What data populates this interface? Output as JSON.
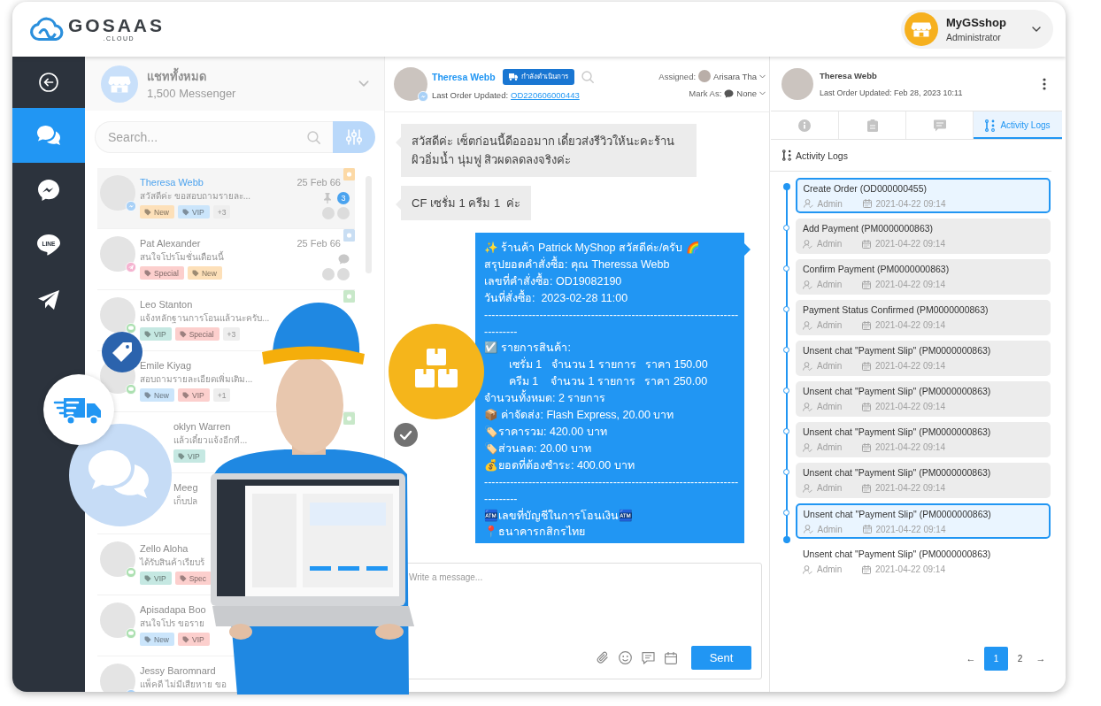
{
  "header": {
    "logo": {
      "name": "GOSAAS",
      "suffix": ".CLOUD"
    },
    "account": {
      "name": "MyGSshop",
      "role": "Administrator"
    }
  },
  "sidebar": {
    "items": [
      {
        "kind": "chats",
        "selected": true
      },
      {
        "kind": "messenger",
        "selected": false
      },
      {
        "kind": "line",
        "label": "LINE",
        "selected": false
      },
      {
        "kind": "send",
        "selected": false
      }
    ]
  },
  "chat_list": {
    "title": "แชททั้งหมด",
    "subtitle": "1,500 Messenger",
    "search": {
      "placeholder": "Search..."
    },
    "conversations": [
      {
        "name": "Theresa Webb",
        "preview": "สวัสดีค่ะ ขอสอบถามรายละ...",
        "date": "25 Feb 66",
        "channel": {
          "kind": "messenger"
        },
        "color": "#fcd9a6",
        "indicator": {
          "kind": "pinned"
        },
        "unread": "3",
        "tags": [
          {
            "label": "New",
            "color": "#fde0b9"
          },
          {
            "label": "VIP",
            "color": "#cbe5fb"
          }
        ],
        "more": "+3",
        "selected": true
      },
      {
        "name": "Pat Alexander",
        "preview": "สนใจโปรโมชั่นเดือนนี้",
        "date": "25 Feb 66",
        "channel": {
          "kind": "instagram"
        },
        "color": "#c9def3",
        "indicator": {
          "kind": "replied"
        },
        "tags": [
          {
            "label": "Special",
            "color": "#fccfcd"
          },
          {
            "label": "New",
            "color": "#fde0b9"
          }
        ],
        "selected": false
      },
      {
        "name": "Leo Stanton",
        "preview": "แจ้งหลักฐานการโอนแล้วนะครับ...",
        "channel": {
          "kind": "line"
        },
        "color": "#c8e8c9",
        "tags": [
          {
            "label": "VIP",
            "color": "#c5e8e2"
          },
          {
            "label": "Special",
            "color": "#fccfcd"
          }
        ],
        "more": "+3",
        "selected": false
      },
      {
        "name": "Emile Kiyag",
        "preview": "สอบถามรายละเอียดเพิ่มเติม...",
        "channel": {
          "kind": "line"
        },
        "tags": [
          {
            "label": "New",
            "color": "#cbe5fb"
          },
          {
            "label": "VIP",
            "color": "#fccfcd"
          }
        ],
        "more": "+1",
        "selected": false
      },
      {
        "name": "oklyn Warren",
        "preview": "แล้วเดี๋ยวแจ้งอีกที...",
        "color": "#c8e8c9",
        "tags": [
          {
            "label": "VIP",
            "color": "#c5e8e2"
          }
        ],
        "selected": false
      },
      {
        "name": "Meeg",
        "preview": "เก็บปล",
        "selected": false
      },
      {
        "name": "Zello Aloha",
        "preview": "ได้รับสินค้าเรียบร้",
        "channel": {
          "kind": "line"
        },
        "tags": [
          {
            "label": "VIP",
            "color": "#c5e8e2"
          },
          {
            "label": "Spec",
            "color": "#fccfcd"
          }
        ],
        "selected": false
      },
      {
        "name": "Apisadapa Boo",
        "preview": "สนใจโปร ขอราย",
        "channel": {
          "kind": "line"
        },
        "tags": [
          {
            "label": "New",
            "color": "#cbe5fb"
          },
          {
            "label": "VIP",
            "color": "#fccfcd"
          }
        ],
        "selected": false
      },
      {
        "name": "Jessy Baromnard",
        "preview": "แพ็คดี ไม่มีเสียหาย ขอ",
        "channel": {
          "kind": "messenger"
        },
        "selected": false
      }
    ]
  },
  "conversation": {
    "contact": {
      "name": "Theresa Webb",
      "channel": {
        "kind": "messenger"
      },
      "status": "กำลังดำเนินการ",
      "order_label": "Last Order Updated:",
      "order_id": "OD220606000443"
    },
    "assigned": {
      "label": "Assigned:",
      "value": "Arisara Tha"
    },
    "mark_as": {
      "label": "Mark As:",
      "value": "None"
    },
    "messages": [
      {
        "kind": "incoming",
        "text": "สวัสดีค่ะ เซ็ตก่อนนี้ดีอออมาก เดี๋ยวส่งรีวิวให้นะคะร้าน ผิวอิ่มน้ำ นุ่มฟู สิวผดลดลงจริงค่ะ"
      },
      {
        "kind": "incoming",
        "text": "CF เซรั่ม 1 ครีม 1  ค่ะ"
      },
      {
        "kind": "outgoing",
        "text": "✨ ร้านค้า Patrick MyShop สวัสดีค่ะ/ครับ 🌈\nสรุปยอดคำสั่งซื้อ: คุณ Theressa Webb\nเลขที่คำสั่งซื้อ: OD19082190\nวันที่สั่งซื้อ:  2023-02-28 11:00\n------------------------------------------------------------------------------\n☑️ รายการสินค้า:\n        เซรั่ม 1   จำนวน 1 รายการ   ราคา 150.00\n        ครีม 1    จำนวน 1 รายการ   ราคา 250.00\nจำนวนทั้งหมด: 2 รายการ\n📦 ค่าจัดส่ง: Flash Express, 20.00 บาท\n🏷️ราคารวม: 420.00 บาท\n🏷️ส่วนลด: 20.00 บาท\n💰ยอดที่ต้องชำระ: 400.00 บาท\n------------------------------------------------------------------------------\n🏧เลขที่บัญชีในการโอนเงิน🏧\n📍ธนาคารกสิกรไทย"
      }
    ],
    "composer": {
      "placeholder": "Write a message...",
      "send": "Sent"
    }
  },
  "details": {
    "contact": {
      "name": "Theresa Webb",
      "updated": "Last Order Updated: Feb 28, 2023 10:11"
    },
    "tabs": [
      {
        "kind": "info",
        "selected": false
      },
      {
        "kind": "notes",
        "selected": false
      },
      {
        "kind": "chat",
        "selected": false
      },
      {
        "kind": "logs",
        "label": "Activity Logs",
        "selected": true
      }
    ],
    "section_title": "Activity Logs",
    "logs": [
      {
        "kind": "timeline",
        "title": "Create Order (OD000000455)",
        "user": "Admin",
        "time": "2021-04-22 09:14",
        "selected": true
      },
      {
        "kind": "timeline",
        "title": "Add Payment (PM0000000863)",
        "user": "Admin",
        "time": "2021-04-22 09:14",
        "selected": false
      },
      {
        "kind": "timeline",
        "title": "Confirm Payment (PM0000000863)",
        "user": "Admin",
        "time": "2021-04-22 09:14",
        "selected": false
      },
      {
        "kind": "timeline",
        "title": "Payment Status Confirmed (PM0000000863)",
        "user": "Admin",
        "time": "2021-04-22 09:14",
        "selected": false
      },
      {
        "kind": "timeline",
        "title": "Unsent chat \"Payment Slip\" (PM0000000863)",
        "user": "Admin",
        "time": "2021-04-22 09:14",
        "selected": false
      },
      {
        "kind": "timeline",
        "title": "Unsent chat \"Payment Slip\" (PM0000000863)",
        "user": "Admin",
        "time": "2021-04-22 09:14",
        "selected": false
      },
      {
        "kind": "timeline",
        "title": "Unsent chat \"Payment Slip\" (PM0000000863)",
        "user": "Admin",
        "time": "2021-04-22 09:14",
        "selected": false
      },
      {
        "kind": "timeline",
        "title": "Unsent chat \"Payment Slip\" (PM0000000863)",
        "user": "Admin",
        "time": "2021-04-22 09:14",
        "selected": false
      },
      {
        "kind": "timeline",
        "title": "Unsent chat \"Payment Slip\" (PM0000000863)",
        "user": "Admin",
        "time": "2021-04-22 09:14",
        "selected": true
      },
      {
        "kind": "plain",
        "title": "Unsent chat \"Payment Slip\" (PM0000000863)",
        "user": "Admin",
        "time": "2021-04-22 09:14",
        "selected": false
      }
    ],
    "pagination": {
      "previous": "←",
      "pages": [
        {
          "label": "1",
          "selected": true
        },
        {
          "label": "2",
          "selected": false
        }
      ],
      "next": "→"
    }
  }
}
